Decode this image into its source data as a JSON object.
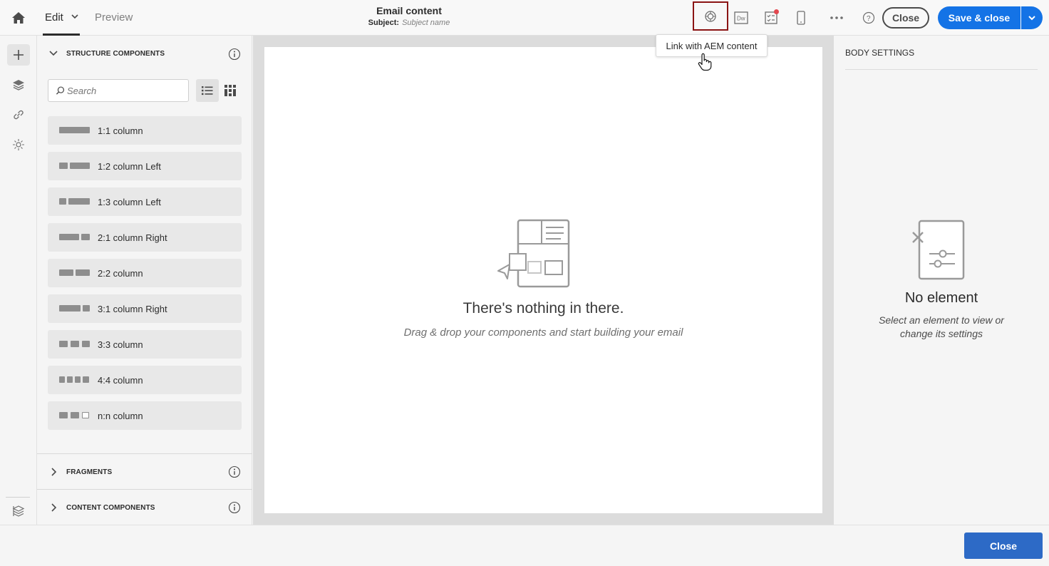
{
  "header": {
    "mode_edit": "Edit",
    "mode_preview": "Preview",
    "title": "Email content",
    "subject_label": "Subject:",
    "subject_value": "Subject name",
    "close_label": "Close",
    "save_close_label": "Save & close",
    "tooltip": "Link with AEM content",
    "icons": [
      "home-icon",
      "aem-link-icon",
      "dreamweaver-icon",
      "checklist-icon",
      "mobile-icon",
      "more-icon",
      "help-icon"
    ],
    "accent_color": "#1473e6"
  },
  "rail": {
    "items": [
      "add-icon",
      "layers-icon",
      "link-icon",
      "personalization-icon",
      "settings-layers-icon"
    ]
  },
  "left_panel": {
    "structure_title": "STRUCTURE COMPONENTS",
    "search_placeholder": "Search",
    "components": [
      {
        "label": "1:1 column"
      },
      {
        "label": "1:2 column Left"
      },
      {
        "label": "1:3 column Left"
      },
      {
        "label": "2:1 column Right"
      },
      {
        "label": "2:2 column"
      },
      {
        "label": "3:1 column Right"
      },
      {
        "label": "3:3 column"
      },
      {
        "label": "4:4 column"
      },
      {
        "label": "n:n column"
      }
    ],
    "fragments_title": "FRAGMENTS",
    "content_title": "CONTENT COMPONENTS"
  },
  "canvas": {
    "empty_title": "There's nothing in there.",
    "empty_sub": "Drag & drop your components and start building your email"
  },
  "right_panel": {
    "title": "BODY SETTINGS",
    "no_element": "No element",
    "no_element_sub": "Select an element to view or change its settings"
  },
  "footer": {
    "close_label": "Close",
    "close_color": "#2d6ac6"
  }
}
